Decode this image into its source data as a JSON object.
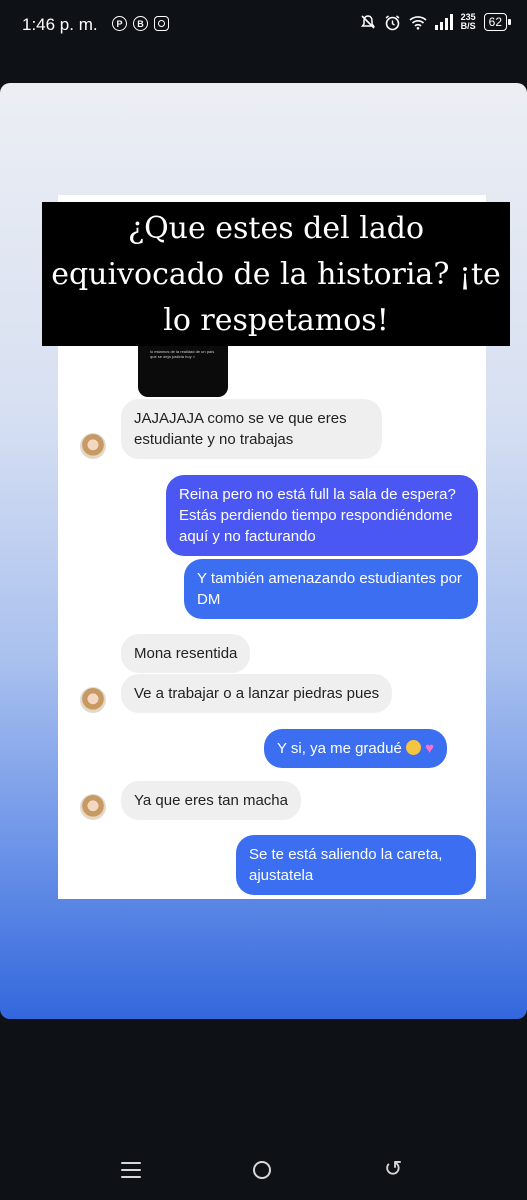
{
  "status_bar": {
    "time": "1:46 p. m.",
    "left_icons": [
      "pinterest-icon",
      "b-icon",
      "instagram-icon"
    ],
    "right_icons": [
      "mute-bell-icon",
      "alarm-icon",
      "wifi-icon",
      "signal-icon"
    ],
    "speed_value": "235",
    "speed_unit": "B/S",
    "battery": "62"
  },
  "story": {
    "headline": "¿Que estes del lado equivocado de la historia? ¡te lo respetamos!",
    "thumb_text": "lo estamos de la realidad de un país que se deja justicia hoy >",
    "colors": {
      "sent_bubble": "#4b57f2",
      "sent_bubble_alt": "#3b6ef0",
      "received_bubble": "#efefef"
    },
    "messages": [
      {
        "side": "received",
        "text": "JAJAJAJA como se ve que eres estudiante y no trabajas"
      },
      {
        "side": "sent",
        "text": "Reina pero no está full la sala de espera? Estás perdiendo tiempo respondiéndome aquí y no facturando"
      },
      {
        "side": "sent",
        "text": "Y también amenazando estudiantes por DM"
      },
      {
        "side": "received",
        "text": "Mona resentida"
      },
      {
        "side": "received",
        "text": "Ve a trabajar o a lanzar piedras pues"
      },
      {
        "side": "sent",
        "text": "Y si, ya me gradué"
      },
      {
        "side": "received",
        "text": "Ya que eres tan macha"
      },
      {
        "side": "sent",
        "text": "Se te está saliendo la careta, ajustatela"
      }
    ]
  },
  "nav_bar": {
    "icons": [
      "recent-apps-icon",
      "home-icon",
      "back-icon"
    ]
  }
}
